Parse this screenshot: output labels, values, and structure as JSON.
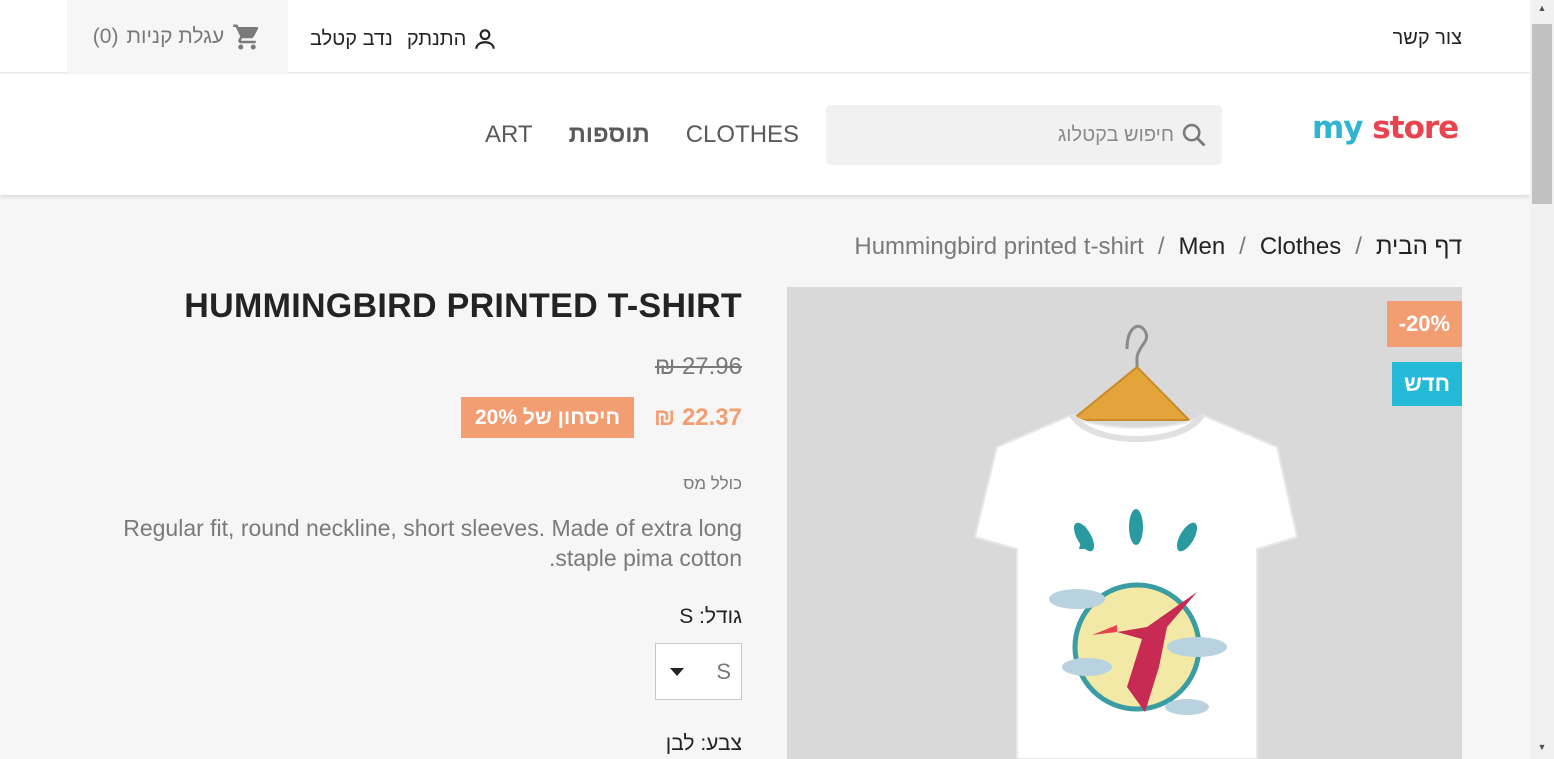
{
  "topbar": {
    "contact": "צור קשר",
    "user_name": "נדב קטלב",
    "logout": "התנתק",
    "cart_label": "עגלת קניות",
    "cart_count": "(0)"
  },
  "header": {
    "logo": {
      "part1": "my",
      "part2": " store"
    },
    "search_placeholder": "חיפוש בקטלוג",
    "menu": [
      "CLOTHES",
      "תוספות",
      "ART"
    ]
  },
  "breadcrumb": [
    "דף הבית",
    "Clothes",
    "Men",
    "Hummingbird printed t-shirt"
  ],
  "product": {
    "title": "HUMMINGBIRD PRINTED T-SHIRT",
    "old_price": "27.96 ₪",
    "price": "22.37 ₪",
    "save_label": "חיסחון של 20%",
    "tax_label": "כולל מס",
    "description": "Regular fit, round neckline, short sleeves. Made of extra long staple pima cotton.",
    "size_label": "גודל: S",
    "size_value": "S",
    "color_label": "צבע: לבן",
    "flags": {
      "discount": "-20%",
      "new": "חדש"
    }
  },
  "colors": {
    "accent": "#f39d72",
    "new_flag": "#24b9d7",
    "logo_a": "#2fb5d2",
    "logo_b": "#e8434f"
  }
}
